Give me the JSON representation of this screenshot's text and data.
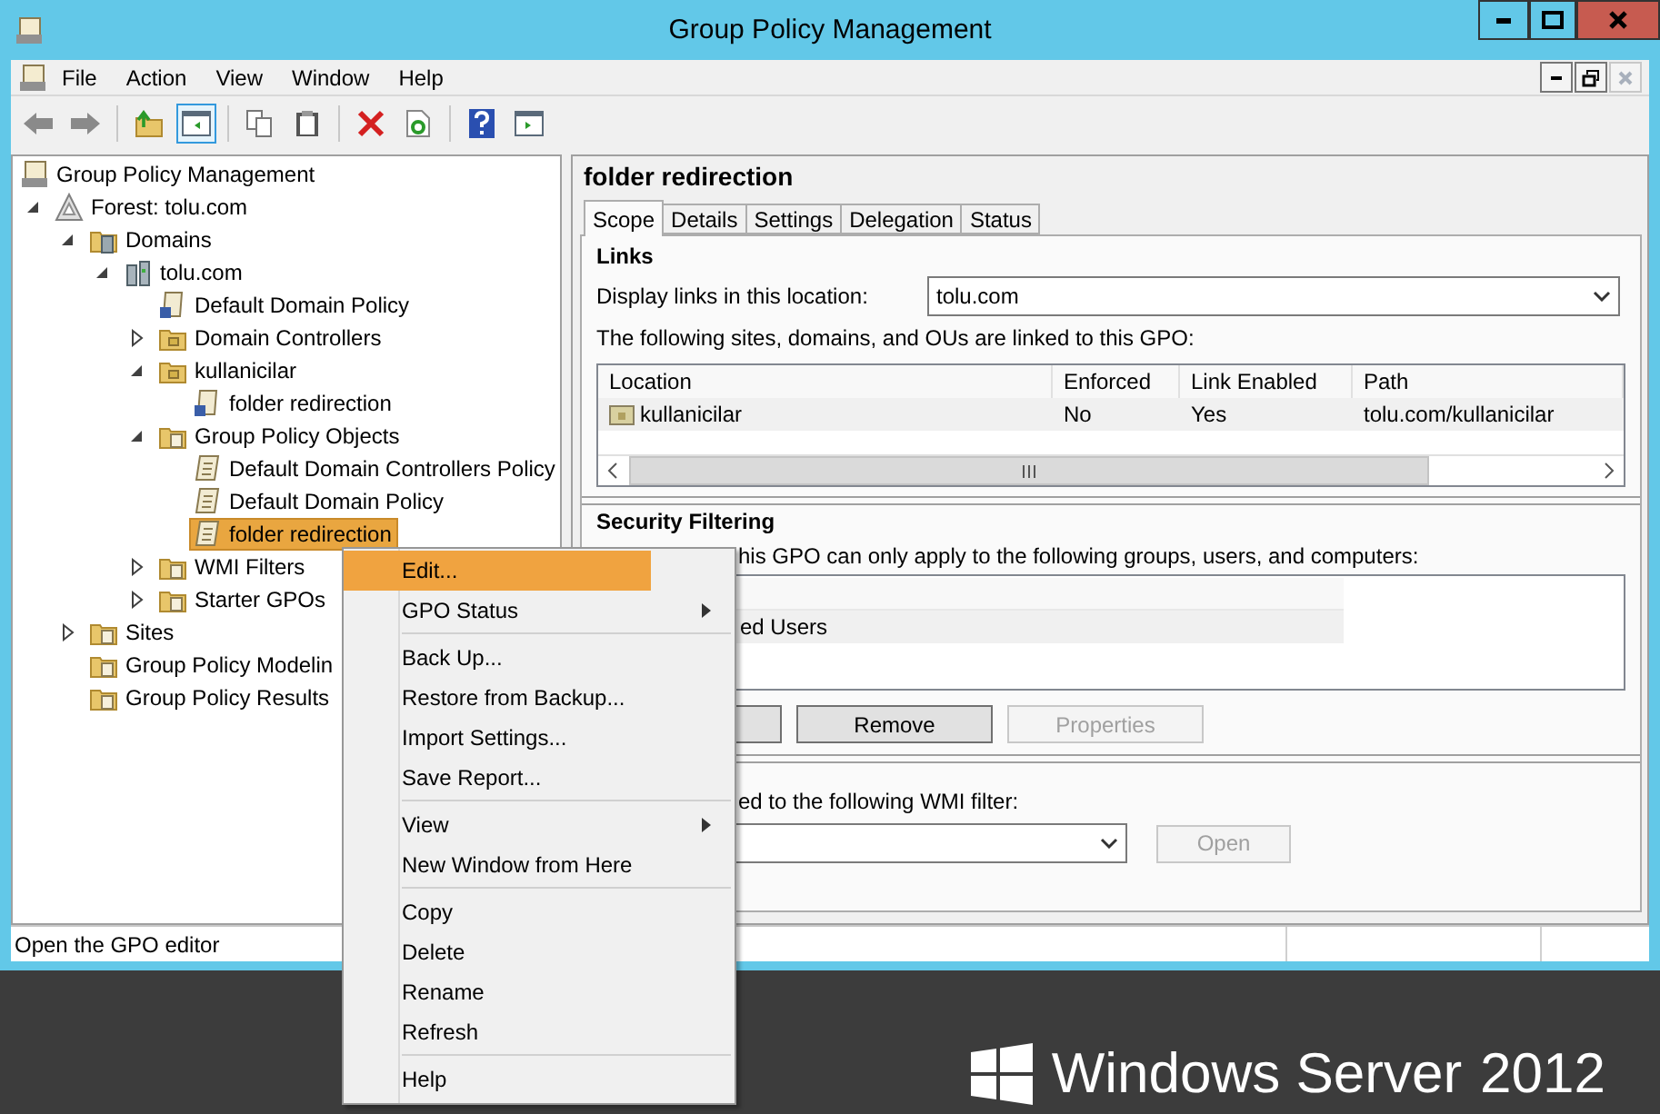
{
  "window": {
    "title": "Group Policy Management"
  },
  "menu_bar": [
    "File",
    "Action",
    "View",
    "Window",
    "Help"
  ],
  "tree": [
    {
      "label": "Group Policy Management",
      "kind": "console",
      "selected": false,
      "children": [
        {
          "label": "Forest: tolu.com",
          "kind": "forest",
          "expanded": true,
          "selected": false,
          "children": [
            {
              "label": "Domains",
              "kind": "domains",
              "expanded": true,
              "selected": false,
              "children": [
                {
                  "label": "tolu.com",
                  "kind": "domain",
                  "expanded": true,
                  "selected": false,
                  "children": [
                    {
                      "label": "Default Domain Policy",
                      "kind": "link",
                      "selected": false
                    },
                    {
                      "label": "Domain Controllers",
                      "kind": "ou",
                      "expanded": false,
                      "selected": false
                    },
                    {
                      "label": "kullanicilar",
                      "kind": "ou",
                      "expanded": true,
                      "selected": false,
                      "children": [
                        {
                          "label": "folder redirection",
                          "kind": "link",
                          "selected": false
                        }
                      ]
                    },
                    {
                      "label": "Group Policy Objects",
                      "kind": "folder",
                      "expanded": true,
                      "selected": false,
                      "children": [
                        {
                          "label": "Default Domain Controllers Policy",
                          "kind": "gpo",
                          "selected": false
                        },
                        {
                          "label": "Default Domain Policy",
                          "kind": "gpo",
                          "selected": false
                        },
                        {
                          "label": "folder redirection",
                          "kind": "gpo",
                          "selected": true
                        }
                      ]
                    },
                    {
                      "label": "WMI Filters",
                      "kind": "folder",
                      "expanded": false,
                      "selected": false
                    },
                    {
                      "label": "Starter GPOs",
                      "kind": "folder",
                      "expanded": false,
                      "selected": false
                    }
                  ]
                }
              ]
            },
            {
              "label": "Sites",
              "kind": "folder",
              "expanded": false,
              "selected": false
            },
            {
              "label": "Group Policy Modelin",
              "kind": "folder",
              "selected": false
            },
            {
              "label": "Group Policy Results",
              "kind": "folder",
              "selected": false
            }
          ]
        }
      ]
    }
  ],
  "details": {
    "title": "folder redirection",
    "tabs": [
      {
        "label": "Scope",
        "selected": true
      },
      {
        "label": "Details",
        "selected": false
      },
      {
        "label": "Settings",
        "selected": false
      },
      {
        "label": "Delegation",
        "selected": false
      },
      {
        "label": "Status",
        "selected": false
      }
    ],
    "links": {
      "heading": "Links",
      "location_label": "Display links in this location:",
      "location_value": "tolu.com",
      "caption": "The following sites, domains, and OUs are linked to this GPO:",
      "columns": [
        "Location",
        "Enforced",
        "Link Enabled",
        "Path"
      ],
      "rows": [
        [
          "kullanicilar",
          "No",
          "Yes",
          "tolu.com/kullanicilar"
        ]
      ]
    },
    "security": {
      "heading": "Security Filtering",
      "caption": "his GPO can only apply to the following groups, users, and computers:",
      "rows": [
        "ed Users"
      ],
      "buttons": [
        {
          "label": "Remove",
          "disabled": false
        },
        {
          "label": "Properties",
          "disabled": true
        }
      ]
    },
    "wmi": {
      "caption": "ed to the following WMI filter:",
      "button": {
        "label": "Open",
        "disabled": true
      }
    }
  },
  "status_bar": "Open the GPO editor",
  "context_menu": [
    {
      "kind": "item",
      "label": "Edit...",
      "selected": true,
      "submenu": false
    },
    {
      "kind": "item",
      "label": "GPO Status",
      "selected": false,
      "submenu": true
    },
    {
      "kind": "separator"
    },
    {
      "kind": "item",
      "label": "Back Up...",
      "selected": false,
      "submenu": false
    },
    {
      "kind": "item",
      "label": "Restore from Backup...",
      "selected": false,
      "submenu": false
    },
    {
      "kind": "item",
      "label": "Import Settings...",
      "selected": false,
      "submenu": false
    },
    {
      "kind": "item",
      "label": "Save Report...",
      "selected": false,
      "submenu": false
    },
    {
      "kind": "separator"
    },
    {
      "kind": "item",
      "label": "View",
      "selected": false,
      "submenu": true
    },
    {
      "kind": "item",
      "label": "New Window from Here",
      "selected": false,
      "submenu": false
    },
    {
      "kind": "separator"
    },
    {
      "kind": "item",
      "label": "Copy",
      "selected": false,
      "submenu": false
    },
    {
      "kind": "item",
      "label": "Delete",
      "selected": false,
      "submenu": false
    },
    {
      "kind": "item",
      "label": "Rename",
      "selected": false,
      "submenu": false
    },
    {
      "kind": "item",
      "label": "Refresh",
      "selected": false,
      "submenu": false
    },
    {
      "kind": "separator"
    },
    {
      "kind": "item",
      "label": "Help",
      "selected": false,
      "submenu": false
    }
  ],
  "branding": {
    "name": "Windows Server",
    "version": "2012"
  }
}
